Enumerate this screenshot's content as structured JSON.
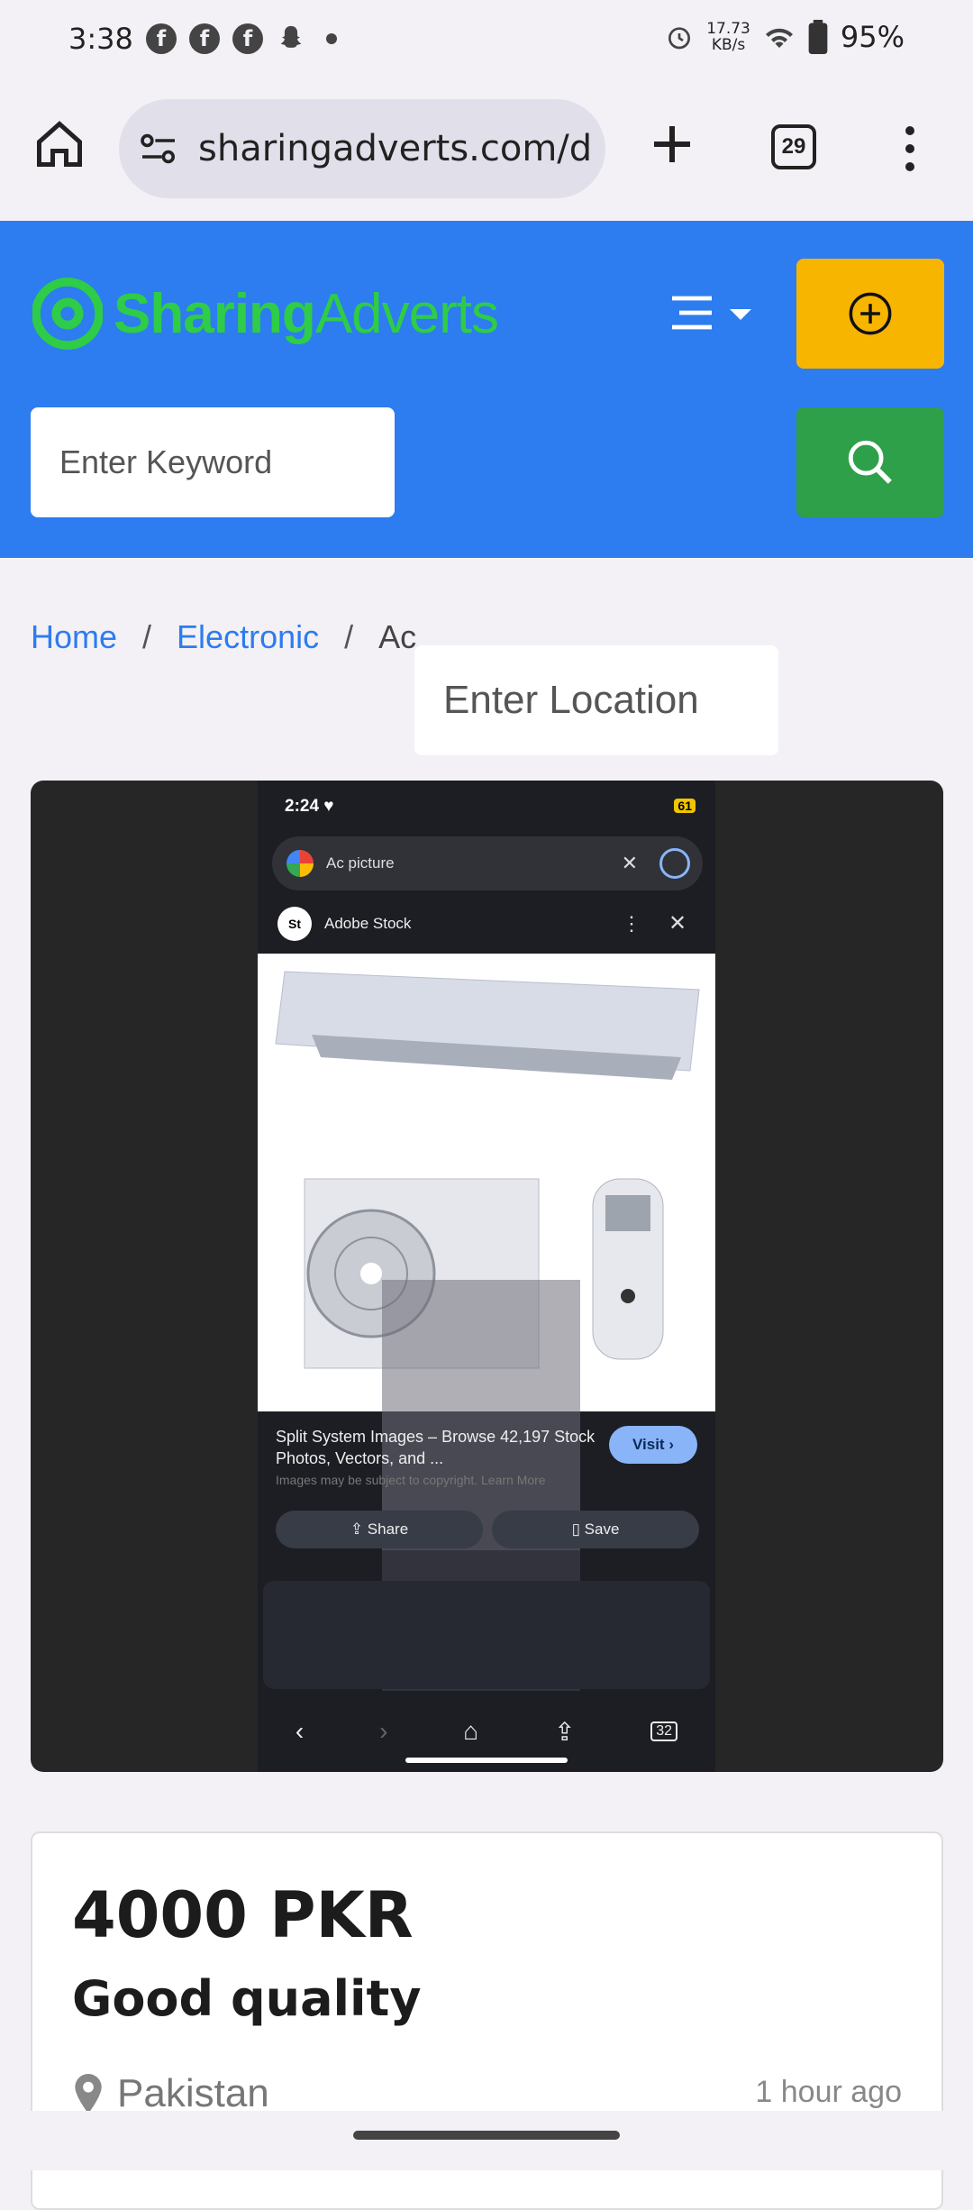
{
  "status_bar": {
    "time": "3:38",
    "net_speed_value": "17.73",
    "net_speed_unit": "KB/s",
    "battery": "95%",
    "notif_icons": [
      "facebook-icon",
      "facebook-icon",
      "facebook-icon",
      "snapchat-icon"
    ]
  },
  "browser": {
    "url": "sharingadverts.com/d",
    "tab_count": "29"
  },
  "site": {
    "logo_primary": "Sharing",
    "logo_secondary": "Adverts",
    "brand_color": "#2d7cf0",
    "accent_color": "#f8b500",
    "search_color": "#2ea04a",
    "keyword_placeholder": "Enter Keyword",
    "location_placeholder": "Enter Location"
  },
  "breadcrumb": {
    "items": [
      "Home",
      "Electronic",
      "Ac"
    ],
    "separator": "/"
  },
  "media_screenshot": {
    "time": "2:24",
    "battery": "61",
    "query": "Ac picture",
    "source": "Adobe Stock",
    "source_badge": "St",
    "caption": "Split System Images – Browse 42,197 Stock Photos, Vectors, and ...",
    "copyright": "Images may be subject to copyright. Learn More",
    "visit_label": "Visit",
    "share_label": "Share",
    "save_label": "Save",
    "tabs_count": "32"
  },
  "listing": {
    "price": "4000 PKR",
    "title": "Good quality",
    "location": "Pakistan",
    "posted": "1 hour ago"
  }
}
